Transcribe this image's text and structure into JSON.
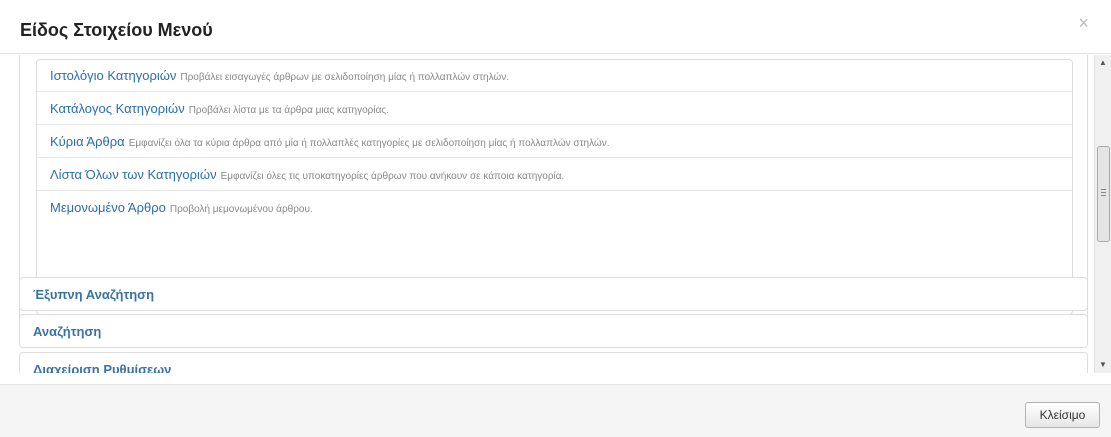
{
  "modal": {
    "title": "Είδος Στοιχείου Μενού",
    "close_icon": "×",
    "scrollbar_grip": "≡"
  },
  "list": {
    "items": [
      {
        "title": "Ιστολόγιο Κατηγοριών",
        "description": "Προβάλει εισαγωγές άρθρων με σελιδοποίηση μίας ή πολλαπλών στηλών."
      },
      {
        "title": "Κατάλογος Κατηγοριών",
        "description": "Προβάλει λίστα με τα άρθρα μιας κατηγορίας."
      },
      {
        "title": "Κύρια Άρθρα",
        "description": "Εμφανίζει όλα τα κύρια άρθρα από μία ή πολλαπλές κατηγορίες με σελιδοποίηση μίας ή πολλαπλών στηλών."
      },
      {
        "title": "Λίστα Όλων των Κατηγοριών",
        "description": "Εμφανίζει όλες τις υποκατηγορίες άρθρων που ανήκουν σε κάποια κατηγορία."
      },
      {
        "title": "Μεμονωμένο Άρθρο",
        "description": "Προβολή μεμονωμένου άρθρου."
      }
    ]
  },
  "groups": [
    {
      "label": "Έξυπνη Αναζήτηση"
    },
    {
      "label": "Αναζήτηση"
    },
    {
      "label": "Διαχείριση Ρυθμίσεων"
    }
  ],
  "footer": {
    "close_label": "Κλείσιμο"
  },
  "colors": {
    "link": "#2a6db4",
    "group_label": "#3a72a8",
    "footer_bg": "#f5f5f5"
  }
}
